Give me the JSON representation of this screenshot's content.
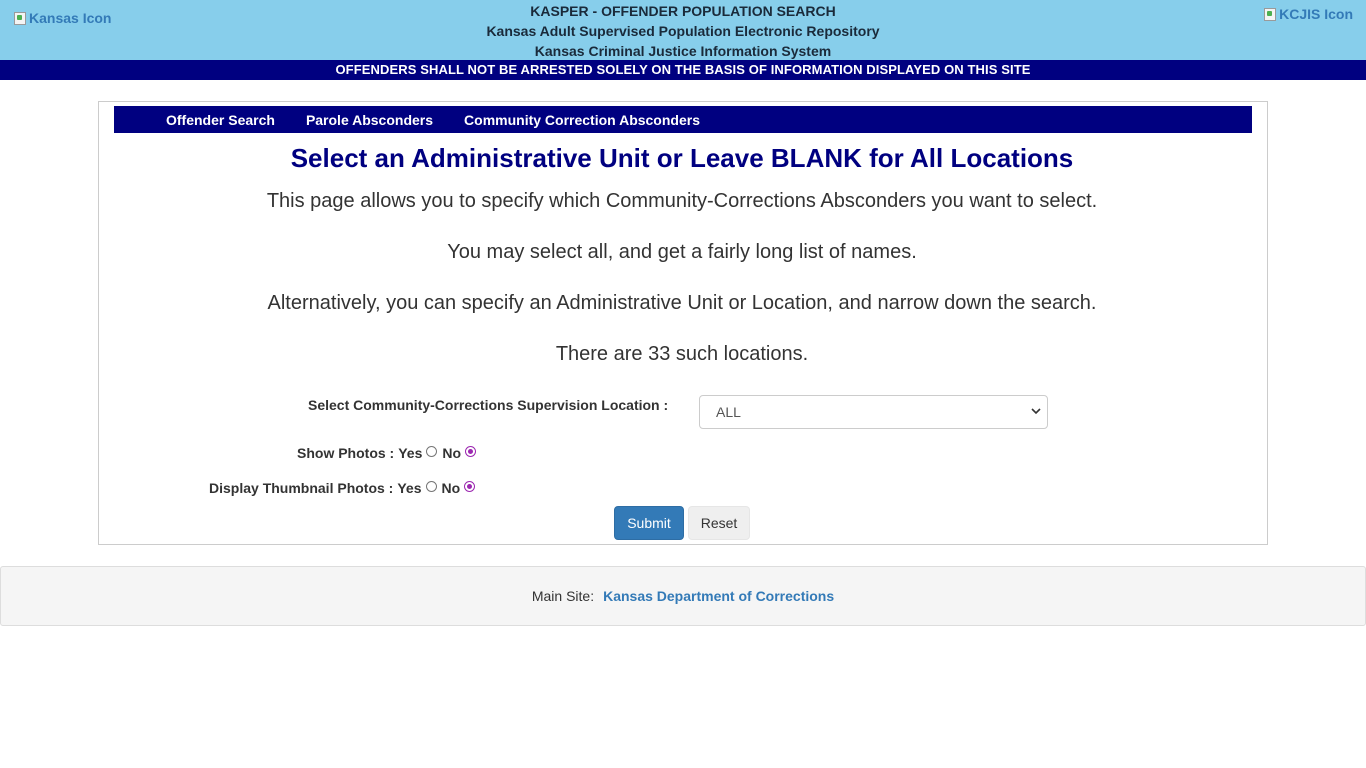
{
  "header": {
    "left_logo_alt": "Kansas Icon",
    "right_logo_alt": "KCJIS Icon",
    "title_line1": "KASPER - OFFENDER POPULATION SEARCH",
    "title_line2": "Kansas Adult Supervised Population Electronic Repository",
    "title_line3": "Kansas Criminal Justice Information System",
    "warning": "OFFENDERS SHALL NOT BE ARRESTED SOLELY ON THE BASIS OF INFORMATION DISPLAYED ON THIS SITE"
  },
  "nav": {
    "items": [
      "Offender Search",
      "Parole Absconders",
      "Community Correction Absconders"
    ]
  },
  "main": {
    "heading": "Select an Administrative Unit or Leave BLANK for All Locations",
    "paragraphs": [
      "This page allows you to specify which Community-Corrections Absconders you want to select.",
      "You may select all, and get a fairly long list of names.",
      "Alternatively, you can specify an Administrative Unit or Location, and narrow down the search.",
      "There are 33 such locations."
    ]
  },
  "form": {
    "location_label": "Select Community-Corrections Supervision Location :",
    "location_selected": "ALL",
    "show_photos_label": "Show Photos :",
    "thumbnail_label": "Display Thumbnail Photos :",
    "yes_label": "Yes",
    "no_label": "No",
    "show_photos_value": "No",
    "thumbnail_value": "No",
    "submit_label": "Submit",
    "reset_label": "Reset"
  },
  "footer": {
    "prefix": "Main Site:",
    "link_text": "Kansas Department of Corrections"
  },
  "colors": {
    "header_bg": "#87ceeb",
    "navy": "#000080",
    "link": "#337ab7",
    "primary_button": "#337ab7",
    "radio_checked": "#9c27b0"
  }
}
